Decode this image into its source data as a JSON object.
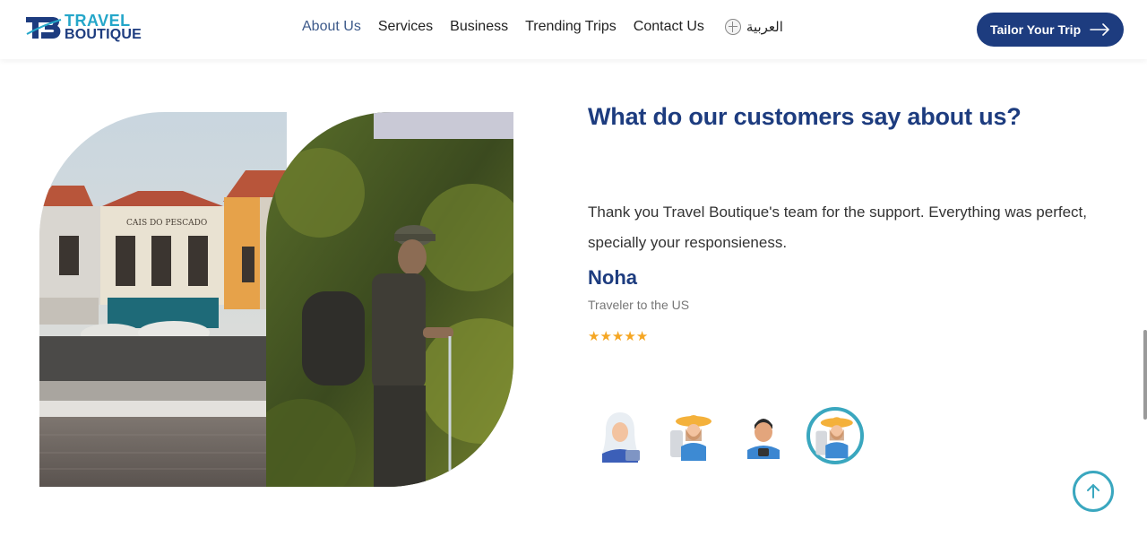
{
  "brand": {
    "line1": "TRAVEL",
    "line2": "BOUTIQUE",
    "mark_letters": "TB",
    "color_primary": "#1d3c7f",
    "color_accent": "#24a6c9"
  },
  "nav": {
    "items": [
      {
        "label": "About Us",
        "active": true
      },
      {
        "label": "Services",
        "active": false
      },
      {
        "label": "Business",
        "active": false
      },
      {
        "label": "Trending Trips",
        "active": false
      },
      {
        "label": "Contact Us",
        "active": false
      }
    ],
    "language": {
      "label": "العربية",
      "icon": "globe-icon"
    }
  },
  "cta": {
    "label": "Tailor Your Trip",
    "icon": "arrow-right-icon"
  },
  "testimonials": {
    "title": "What do our customers say about us?",
    "quote": "Thank you Travel Boutique's team for the support. Everything was perfect, specially your responsieness.",
    "author": "Noha",
    "role": "Traveler to the US",
    "rating": 5,
    "stars": [
      "★",
      "★",
      "★",
      "★",
      "★"
    ],
    "avatars": [
      {
        "name": "hijab-traveler-avatar",
        "selected": false
      },
      {
        "name": "sunhat-traveler-avatar",
        "selected": false
      },
      {
        "name": "male-traveler-avatar",
        "selected": false
      },
      {
        "name": "sunhat-traveler-avatar-2",
        "selected": true
      }
    ]
  },
  "images": {
    "left": "cafe-building-photo",
    "right": "hiker-photo"
  },
  "scroll_top": {
    "icon": "arrow-up-icon"
  }
}
